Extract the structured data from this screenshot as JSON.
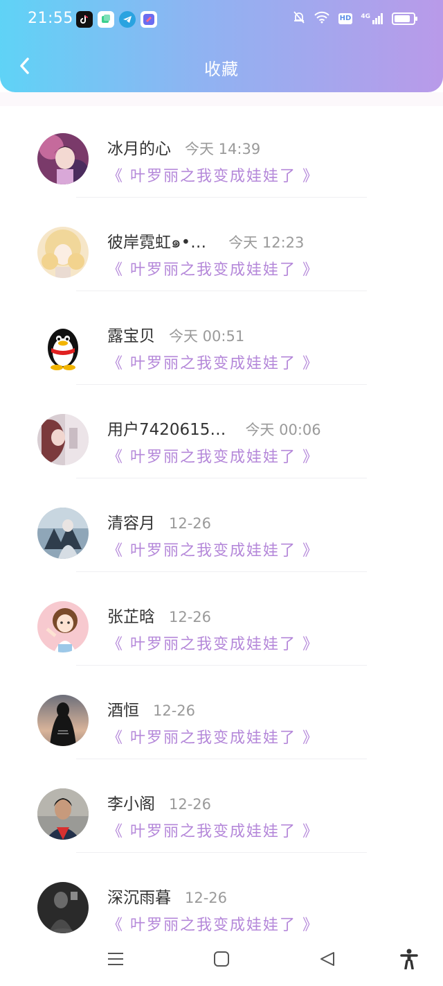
{
  "status": {
    "time": "21:55",
    "hd": "HD",
    "network": "4G",
    "battery_level": 0.85
  },
  "header": {
    "title": "收藏"
  },
  "colors": {
    "header_gradient_start": "#5fd3f6",
    "header_gradient_end": "#b99ae9",
    "book_title": "#b487d9",
    "name": "#333333",
    "time": "#9a9a9a"
  },
  "favorites": [
    {
      "name": "冰月的心",
      "time": "今天 14:39",
      "book": "《 叶罗丽之我变成娃娃了 》"
    },
    {
      "name": "彼岸霓虹๑•…",
      "time": "今天 12:23",
      "book": "《 叶罗丽之我变成娃娃了 》"
    },
    {
      "name": "露宝贝",
      "time": "今天 00:51",
      "book": "《 叶罗丽之我变成娃娃了 》"
    },
    {
      "name": "用户7420615…",
      "time": "今天 00:06",
      "book": "《 叶罗丽之我变成娃娃了 》"
    },
    {
      "name": "清容月",
      "time": "12-26",
      "book": "《 叶罗丽之我变成娃娃了 》"
    },
    {
      "name": "张芷晗",
      "time": "12-26",
      "book": "《 叶罗丽之我变成娃娃了 》"
    },
    {
      "name": "酒恒",
      "time": "12-26",
      "book": "《 叶罗丽之我变成娃娃了 》"
    },
    {
      "name": "李小阁",
      "time": "12-26",
      "book": "《 叶罗丽之我变成娃娃了 》"
    },
    {
      "name": "深沉雨暮",
      "time": "12-26",
      "book": "《 叶罗丽之我变成娃娃了 》"
    }
  ],
  "icons": {
    "back": "chevron-left-icon",
    "menu": "menu-icon",
    "home": "home-square-icon",
    "back_nav": "back-triangle-icon",
    "accessibility": "accessibility-icon"
  }
}
